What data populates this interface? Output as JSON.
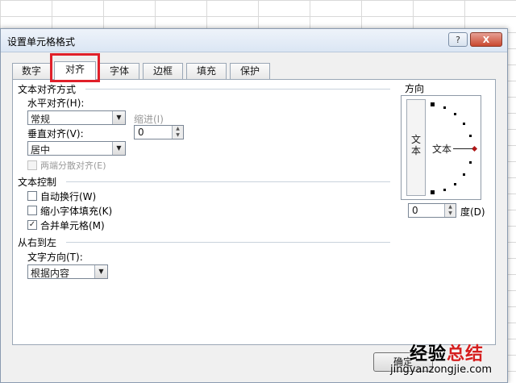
{
  "dialog": {
    "title": "设置单元格格式",
    "help_label": "?",
    "close_label": "X"
  },
  "tabs": [
    {
      "label": "数字"
    },
    {
      "label": "对齐"
    },
    {
      "label": "字体"
    },
    {
      "label": "边框"
    },
    {
      "label": "填充"
    },
    {
      "label": "保护"
    }
  ],
  "text_alignment": {
    "section_title": "文本对齐方式",
    "horizontal_label": "水平对齐(H):",
    "horizontal_value": "常规",
    "indent_label": "缩进(I)",
    "indent_value": "0",
    "vertical_label": "垂直对齐(V):",
    "vertical_value": "居中",
    "justify_distributed_label": "两端分散对齐(E)"
  },
  "text_control": {
    "section_title": "文本控制",
    "wrap_text_label": "自动换行(W)",
    "wrap_text_checked": false,
    "shrink_to_fit_label": "缩小字体填充(K)",
    "shrink_to_fit_checked": false,
    "merge_cells_label": "合并单元格(M)",
    "merge_cells_checked": true
  },
  "rtl": {
    "section_title": "从右到左",
    "direction_label": "文字方向(T):",
    "direction_value": "根据内容"
  },
  "orientation": {
    "section_title": "方向",
    "vertical_text": "文本",
    "dial_text": "文本",
    "degrees_value": "0",
    "degrees_label": "度(D)"
  },
  "buttons": {
    "ok_label": "确定"
  },
  "watermark": {
    "title_black": "经验",
    "title_red": "总结",
    "url": "jingyanzongjie.com"
  },
  "colors": {
    "highlight": "#e0202a"
  }
}
